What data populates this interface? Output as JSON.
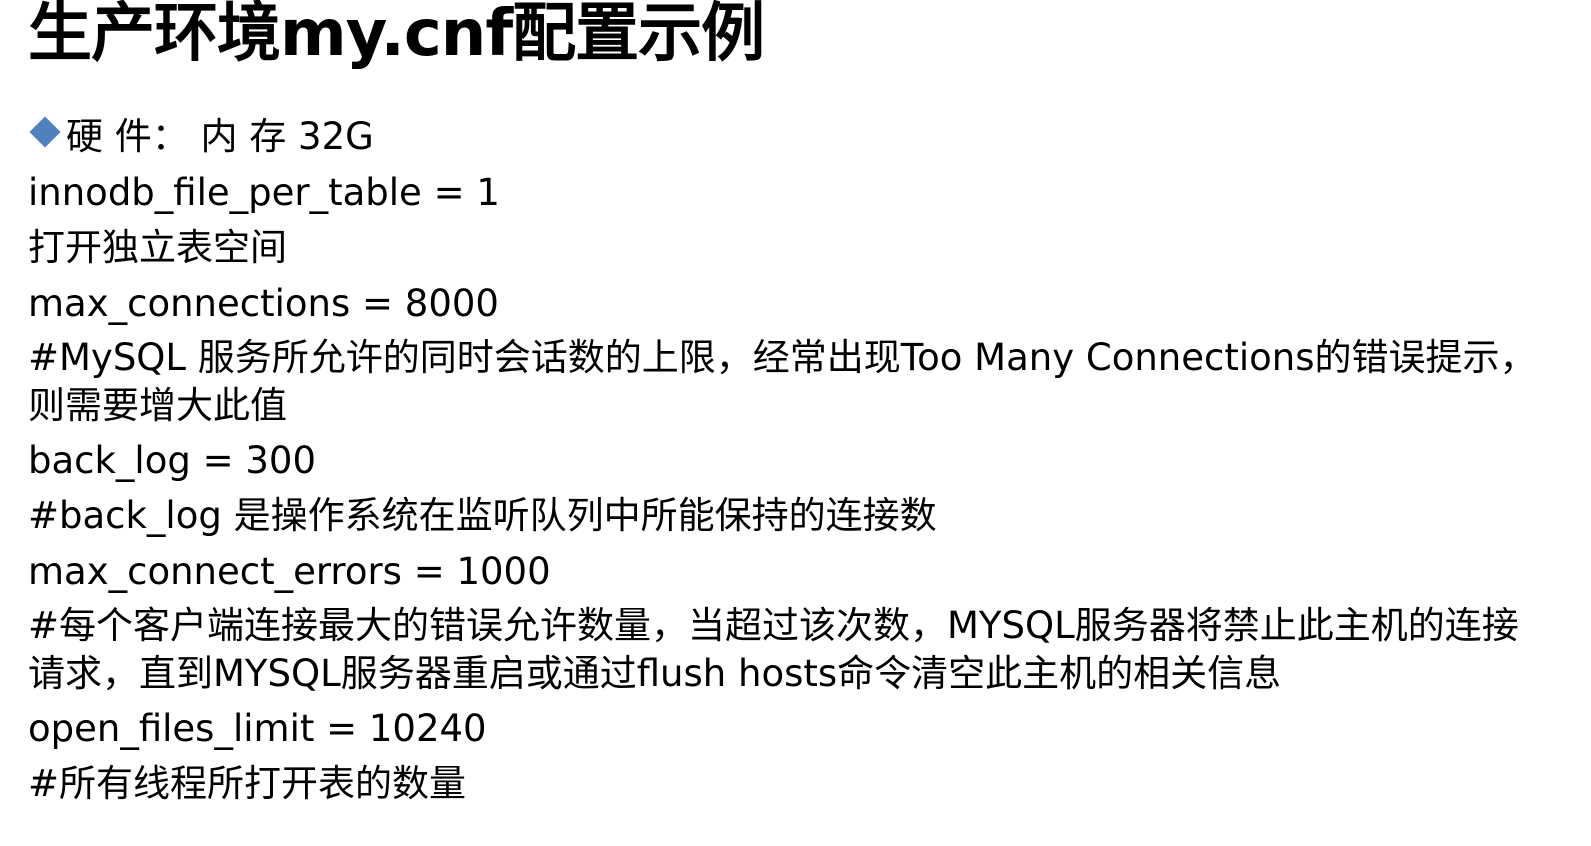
{
  "title": "生产环境my.cnf配置示例",
  "bullet_icon": "diamond-bullet-icon",
  "accent_color": "#4f81bd",
  "lines": [
    "硬 件：  内 存 32G",
    "innodb_file_per_table = 1",
    "打开独立表空间",
    "max_connections = 8000",
    "#MySQL 服务所允许的同时会话数的上限，经常出现Too Many Connections的错误提示，则需要增大此值",
    "back_log = 300",
    "#back_log 是操作系统在监听队列中所能保持的连接数",
    "max_connect_errors = 1000",
    "#每个客户端连接最大的错误允许数量，当超过该次数，MYSQL服务器将禁止此主机的连接请求，直到MYSQL服务器重启或通过flush hosts命令清空此主机的相关信息",
    "open_files_limit = 10240",
    "#所有线程所打开表的数量"
  ]
}
